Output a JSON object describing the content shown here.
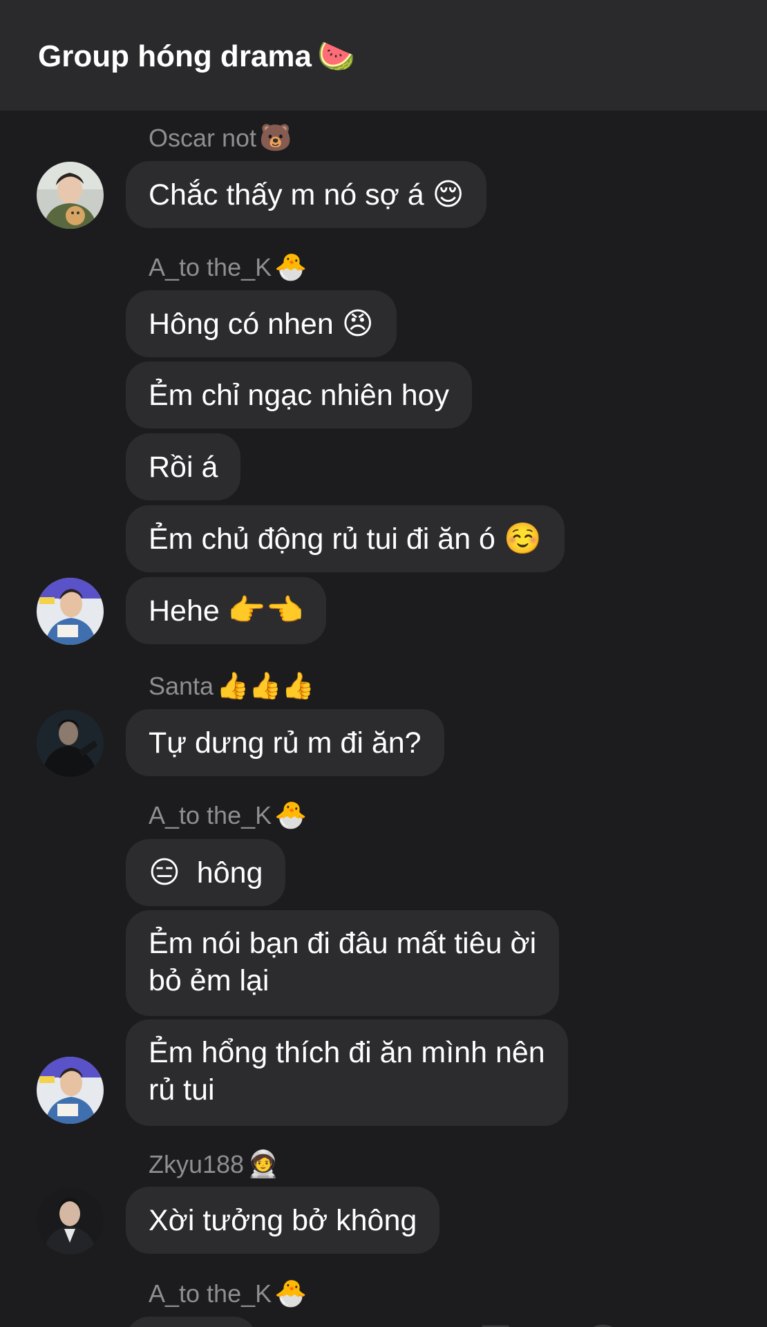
{
  "header": {
    "title": "Group hóng drama",
    "title_emoji": "🍉"
  },
  "messages": [
    {
      "sender": "Oscar not",
      "sender_emoji": "🐻",
      "text": "Chắc thấy m nó sợ á",
      "emoji": "😌"
    },
    {
      "sender": "A_to the_K",
      "sender_emoji": "🐣",
      "text": "Hông có nhen",
      "emoji": "😠"
    },
    {
      "text": "Ẻm chỉ ngạc nhiên hoy"
    },
    {
      "text": "Rồi á"
    },
    {
      "text": "Ẻm chủ động rủ tui đi ăn ó",
      "emoji": "☺️"
    },
    {
      "text": "Hehe",
      "emoji": "👉👈"
    },
    {
      "sender": "Santa",
      "sender_emoji": "👍👍👍",
      "text": "Tự dưng rủ m đi ăn?"
    },
    {
      "sender": "A_to the_K",
      "sender_emoji": "🐣",
      "emoji": "😑",
      "text": "hông"
    },
    {
      "text": "Ẻm nói bạn đi đâu mất tiêu ời\nbỏ ẻm lại"
    },
    {
      "text": "Ẻm hổng thích đi ăn mình nên\nrủ tui"
    },
    {
      "sender": "Zkyu188",
      "sender_emoji": "🧑‍🚀",
      "text": "Xời tưởng bở không"
    },
    {
      "sender": "A_to the_K",
      "sender_emoji": "🐣"
    }
  ],
  "avatars": [
    {
      "name": "Oscar not"
    },
    {
      "name": "A_to the_K"
    },
    {
      "name": "Santa"
    },
    {
      "name": "A_to the_K"
    },
    {
      "name": "Zkyu188"
    }
  ],
  "watermark": "TypeStory",
  "colors": {
    "background": "#1c1c1e",
    "header": "#2a2a2c",
    "bubble": "#2c2c2e",
    "sender_name": "#8e8e93",
    "text": "#ffffff",
    "watermark": "#3a3a3c"
  }
}
